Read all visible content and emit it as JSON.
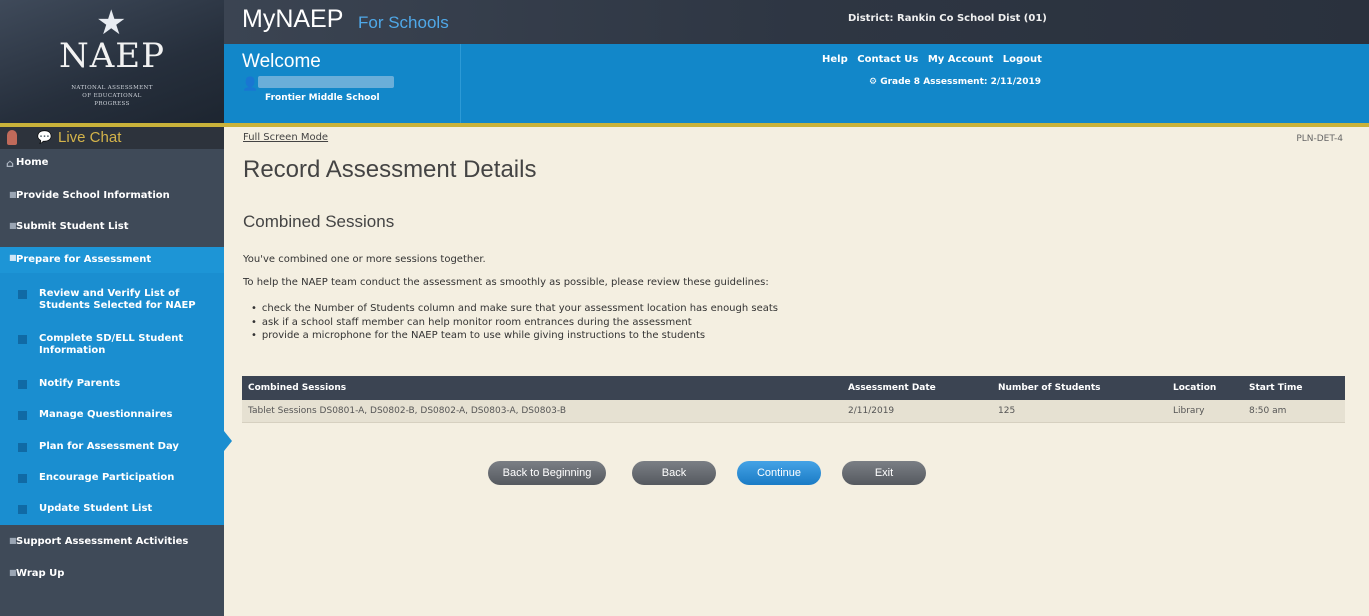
{
  "header": {
    "logo_text": "NAEP",
    "logo_subtext": [
      "NATIONAL ASSESSMENT",
      "OF EDUCATIONAL",
      "PROGRESS"
    ],
    "app_name": "MyNAEP",
    "app_sub": "For Schools",
    "district": "District: Rankin Co School Dist (01)",
    "welcome": "Welcome",
    "school": "Frontier Middle School",
    "links": [
      "Help",
      "Contact Us",
      "My Account",
      "Logout"
    ],
    "assessment": "Grade 8 Assessment: 2/11/2019"
  },
  "sidebar": {
    "live_chat": "Live Chat",
    "home": "Home",
    "items": [
      "Provide School Information",
      "Submit Student List"
    ],
    "active_section": "Prepare for Assessment",
    "sub_items": [
      "Review and Verify List of Students Selected for NAEP",
      "Complete SD/ELL Student Information",
      "Notify Parents",
      "Manage Questionnaires",
      "Plan for Assessment Day",
      "Encourage Participation",
      "Update Student List"
    ],
    "after_items": [
      "Support Assessment Activities",
      "Wrap Up"
    ]
  },
  "main": {
    "fullscreen_link": "Full Screen Mode",
    "page_code": "PLN-DET-4",
    "title": "Record Assessment Details",
    "section_title": "Combined Sessions",
    "intro1": "You've combined one or more sessions together.",
    "intro2": "To help the NAEP team conduct the assessment as smoothly as possible, please review these guidelines:",
    "guidelines": [
      "check the Number of Students column and make sure that your assessment location has enough seats",
      "ask if a school staff member can help monitor room entrances during the assessment",
      "provide a microphone for the NAEP team to use while giving instructions to the students"
    ],
    "table": {
      "headers": [
        "Combined Sessions",
        "Assessment Date",
        "Number of Students",
        "Location",
        "Start Time"
      ],
      "rows": [
        [
          "Tablet Sessions DS0801-A, DS0802-B, DS0802-A, DS0803-A, DS0803-B",
          "2/11/2019",
          "125",
          "Library",
          "8:50 am"
        ]
      ]
    },
    "buttons": {
      "back_to_beginning": "Back to Beginning",
      "back": "Back",
      "continue": "Continue",
      "exit": "Exit"
    }
  },
  "colors": {
    "header_dark": "#2e3643",
    "brand_blue": "#1287c9",
    "gold": "#c9b23a",
    "sidebar": "#3f4a58",
    "background": "#f4efe1"
  }
}
